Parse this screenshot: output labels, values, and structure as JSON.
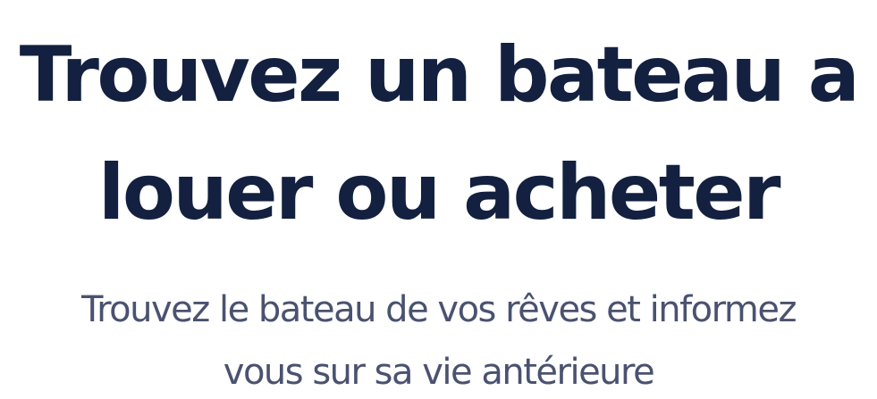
{
  "hero": {
    "title": "Trouvez un bateau a louer ou acheter",
    "subtitle": "Trouvez le bateau de vos rêves et informez vous sur sa vie antérieure"
  },
  "colors": {
    "title": "#13203f",
    "subtitle": "#4a5270",
    "background": "#ffffff"
  }
}
